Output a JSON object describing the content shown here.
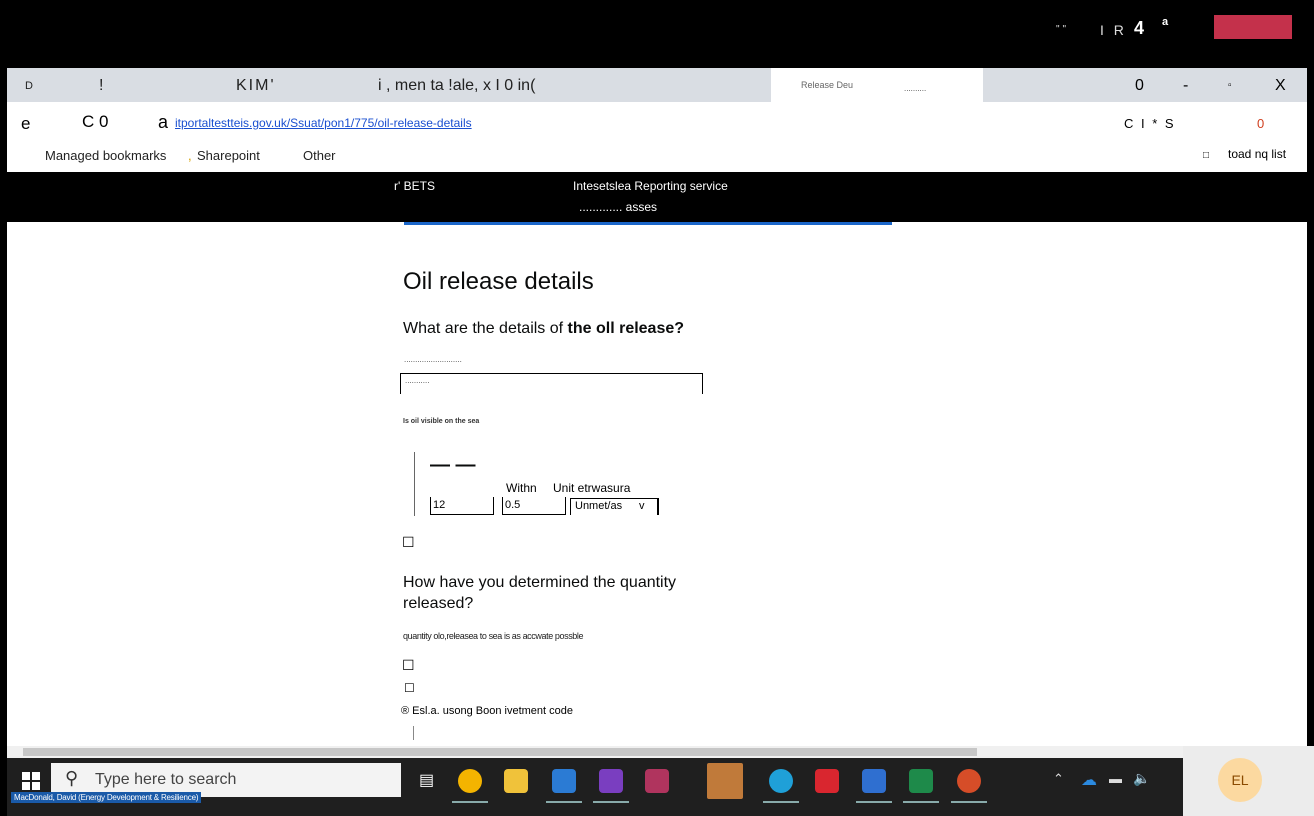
{
  "meeting": {
    "bar_text": "\"\"",
    "ir": "I R",
    "four": "4",
    "sup": "a"
  },
  "tabs": {
    "d": "D",
    "excl": "!",
    "kim": "KIM'",
    "tab_title": "i  , men ta !ale, x I 0 in(",
    "active_tab": "Release Deu",
    "zero": "0",
    "min": "-",
    "box": "▫",
    "close": "X"
  },
  "address": {
    "e": "e",
    "c0": "C 0",
    "a": "a",
    "url": "itportaltestteis.gov.uk/Ssuat/pon1/775/oil-release-details",
    "right": "C I    *    S",
    "right_zero": "0"
  },
  "bookmarks": {
    "managed": "Managed bookmarks",
    "comma": ",",
    "sharepoint": "Sharepoint",
    "other": "Other",
    "reading_icon": "□",
    "reading": "toad nq list"
  },
  "site": {
    "logo": "r' BETS",
    "service": "Intesetslea Reporting service",
    "sub": ".............  asses"
  },
  "page": {
    "title": "Oil release details",
    "question_pre": "What are the details of ",
    "question_bold": "the oll release?",
    "field_label": "..........................",
    "field_value": "...........",
    "visible_label": "Is oil visible on the sea",
    "dash": "— —",
    "within": "Withn",
    "unit_label": "Unit etrwasura",
    "qty": "12",
    "within_val": "0.5",
    "unit": "Unmet/as",
    "unit_arrow": "v",
    "check1": "☐",
    "q2": "How have you determined the quantity released?",
    "q2_hint": "quantity olo,releasea to sea is as accwate possble",
    "check2": "☐",
    "check3": "☐",
    "radio_text": "® Esl.a. usong Boon ivetment code"
  },
  "taskbar": {
    "search": "Type here to search",
    "user": "MacDonald, David (Energy Development & Resilience)",
    "avatar": "EL"
  },
  "colors": {
    "accent": "#1a66c9",
    "red": "#c4314b"
  }
}
